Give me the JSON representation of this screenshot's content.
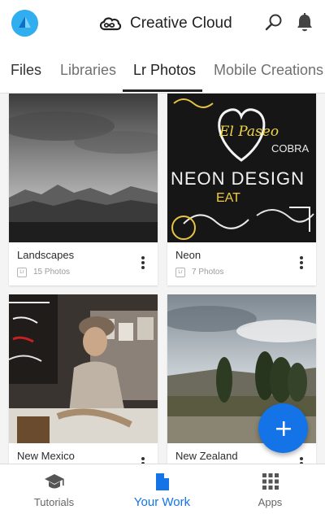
{
  "header": {
    "title": "Creative Cloud",
    "avatar_icon": "prism-avatar-icon",
    "search_icon": "search-icon",
    "notifications_icon": "bell-icon"
  },
  "tabs": [
    {
      "label": "Files",
      "active": false
    },
    {
      "label": "Libraries",
      "active": false
    },
    {
      "label": "Lr Photos",
      "active": true
    },
    {
      "label": "Mobile Creations",
      "active": false
    }
  ],
  "albums": [
    {
      "name": "Landscapes",
      "count": "15 Photos",
      "badge": "Lr"
    },
    {
      "name": "Neon",
      "count": "7 Photos",
      "badge": "Lr"
    },
    {
      "name": "New Mexico",
      "count": "",
      "badge": "Lr"
    },
    {
      "name": "New Zealand",
      "count": "",
      "badge": "Lr"
    }
  ],
  "neon_sign_text": {
    "paseo": "El Paseo",
    "cobra": "COBRA",
    "design": "NEON DESIGN",
    "eat": "EAT"
  },
  "fab": {
    "icon": "plus-icon"
  },
  "bottom_nav": [
    {
      "label": "Tutorials",
      "icon": "graduation-cap-icon",
      "active": false
    },
    {
      "label": "Your Work",
      "icon": "document-icon",
      "active": true
    },
    {
      "label": "Apps",
      "icon": "grid-icon",
      "active": false
    }
  ],
  "colors": {
    "accent": "#1473e6",
    "background": "#f4f4f4"
  }
}
